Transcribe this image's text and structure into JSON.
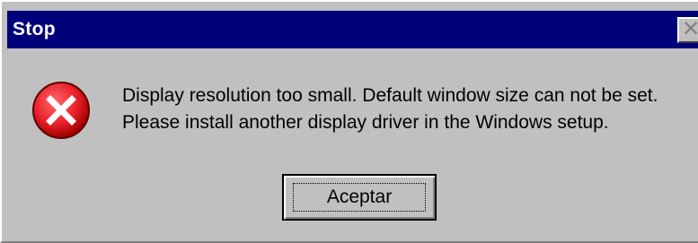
{
  "dialog": {
    "title": "Stop",
    "close_symbol": "✕",
    "icon": "error-icon",
    "message_lines": [
      "Display resolution too small. Default window size can not be set.",
      "Please install another display driver in the Windows setup."
    ],
    "ok_label": "Aceptar"
  },
  "colors": {
    "titlebar": "#00007b",
    "dialog_bg": "#c0c0c0",
    "icon_red": "#e8202a"
  }
}
